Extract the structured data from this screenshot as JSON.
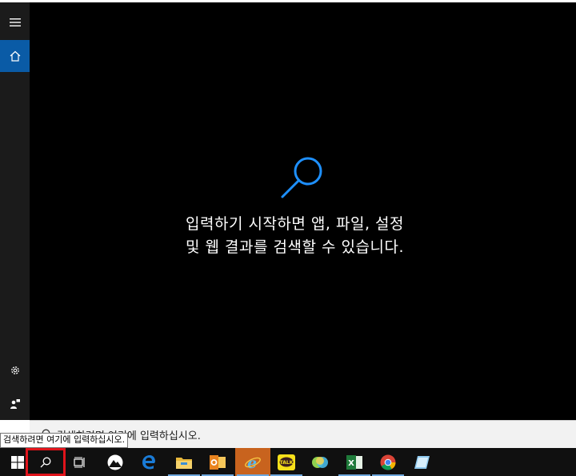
{
  "search_panel": {
    "hint_text": "입력하기 시작하면 앱, 파일, 설정 및 웹 결과를 검색할 수 있습니다.",
    "accent_color": "#1e90ff"
  },
  "rail": {
    "items": [
      {
        "name": "hamburger-menu-icon"
      },
      {
        "name": "home-icon",
        "active": true
      },
      {
        "name": "settings-icon"
      },
      {
        "name": "user-feedback-icon"
      }
    ]
  },
  "searchbox": {
    "placeholder": "검색하려면 여기에 입력하십시오."
  },
  "tooltip": {
    "text": "검색하려면 여기에 입력하십시오."
  },
  "taskbar": {
    "items": [
      {
        "name": "start-button",
        "icon": "windows-logo-icon"
      },
      {
        "name": "search-button",
        "icon": "search-icon"
      },
      {
        "name": "task-view-button",
        "icon": "task-view-icon"
      },
      {
        "name": "mountain-app",
        "icon": "mountain-icon"
      },
      {
        "name": "edge-browser",
        "icon": "edge-icon"
      },
      {
        "name": "file-explorer",
        "icon": "folder-icon"
      },
      {
        "name": "outlook-app",
        "icon": "outlook-icon"
      },
      {
        "name": "internet-explorer",
        "icon": "ie-icon"
      },
      {
        "name": "kakaotalk-app",
        "icon": "kakaotalk-icon",
        "label": "TALK"
      },
      {
        "name": "messenger-app",
        "icon": "bubbles-icon"
      },
      {
        "name": "excel-app",
        "icon": "excel-icon"
      },
      {
        "name": "chrome-browser",
        "icon": "chrome-icon"
      },
      {
        "name": "notes-app",
        "icon": "notes-icon"
      }
    ]
  }
}
